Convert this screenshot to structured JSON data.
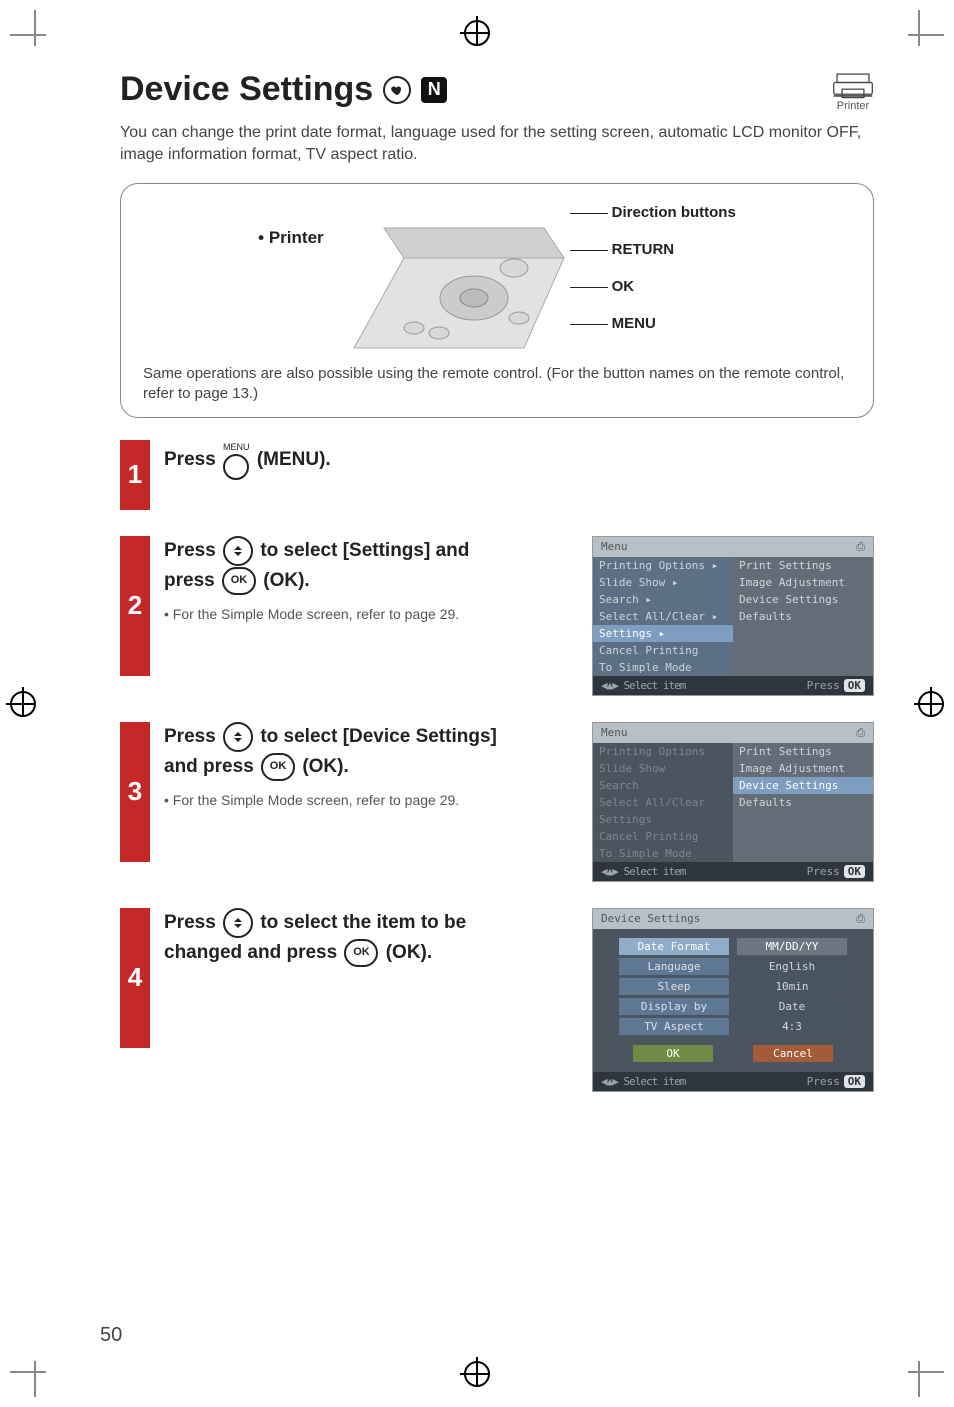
{
  "page_number": "50",
  "title": "Device Settings",
  "title_badge_letter": "N",
  "printer_icon_label": "Printer",
  "intro": "You can change the print date format, language used for the setting screen, automatic LCD monitor OFF, image information format, TV aspect ratio.",
  "device_box": {
    "printer_label": "• Printer",
    "callouts": {
      "direction": "Direction buttons",
      "return": "RETURN",
      "ok": "OK",
      "menu": "MENU"
    },
    "note": "Same operations are also possible using the remote control. (For the button names on the remote control, refer to page 13.)"
  },
  "steps": {
    "s1": {
      "num": "1",
      "pre": "Press ",
      "menu_btn_label": "MENU",
      "post": " (MENU)."
    },
    "s2": {
      "num": "2",
      "line1_pre": "Press ",
      "line1_post": " to select [Settings] and",
      "line2_pre": "press ",
      "ok_label": "OK",
      "line2_post": " (OK).",
      "sub": "• For the Simple Mode screen, refer to page 29."
    },
    "s3": {
      "num": "3",
      "line1_pre": "Press ",
      "line1_post": " to select [Device Settings]",
      "line2_pre": "and press ",
      "ok_label": "OK",
      "line2_post": " (OK).",
      "sub": "• For the Simple Mode screen, refer to page 29."
    },
    "s4": {
      "num": "4",
      "line1_pre": "Press ",
      "line1_post": " to select the item to be",
      "line2_pre": "changed and press ",
      "ok_label": "OK",
      "line2_post": " (OK)."
    }
  },
  "screens": {
    "menu1": {
      "title": "Menu",
      "left": [
        "Printing Options ▸",
        "Slide Show ▸",
        "Search ▸",
        "Select All/Clear ▸",
        "Settings ▸",
        "Cancel Printing",
        "To Simple Mode"
      ],
      "right": [
        "Print Settings",
        "Image Adjustment",
        "Device Settings",
        "Defaults"
      ],
      "foot_left": "◀▲▶ Select item",
      "foot_right_pre": "Press",
      "foot_ok": "OK"
    },
    "menu2": {
      "title": "Menu",
      "left": [
        "Printing Options",
        "Slide Show",
        "Search",
        "Select All/Clear",
        "Settings",
        "Cancel Printing",
        "To Simple Mode"
      ],
      "right": [
        "Print Settings",
        "Image Adjustment",
        "Device Settings",
        "Defaults"
      ],
      "foot_left": "◀▲▶ Select item",
      "foot_right_pre": "Press",
      "foot_ok": "OK"
    },
    "device": {
      "title": "Device Settings",
      "rows": [
        {
          "label": "Date Format",
          "value": "MM/DD/YY"
        },
        {
          "label": "Language",
          "value": "English"
        },
        {
          "label": "Sleep",
          "value": "10min"
        },
        {
          "label": "Display by",
          "value": "Date"
        },
        {
          "label": "TV Aspect",
          "value": "4:3"
        }
      ],
      "btn_ok": "OK",
      "btn_cancel": "Cancel",
      "foot_left": "◀▲▶ Select item",
      "foot_right_pre": "Press",
      "foot_ok": "OK"
    }
  }
}
